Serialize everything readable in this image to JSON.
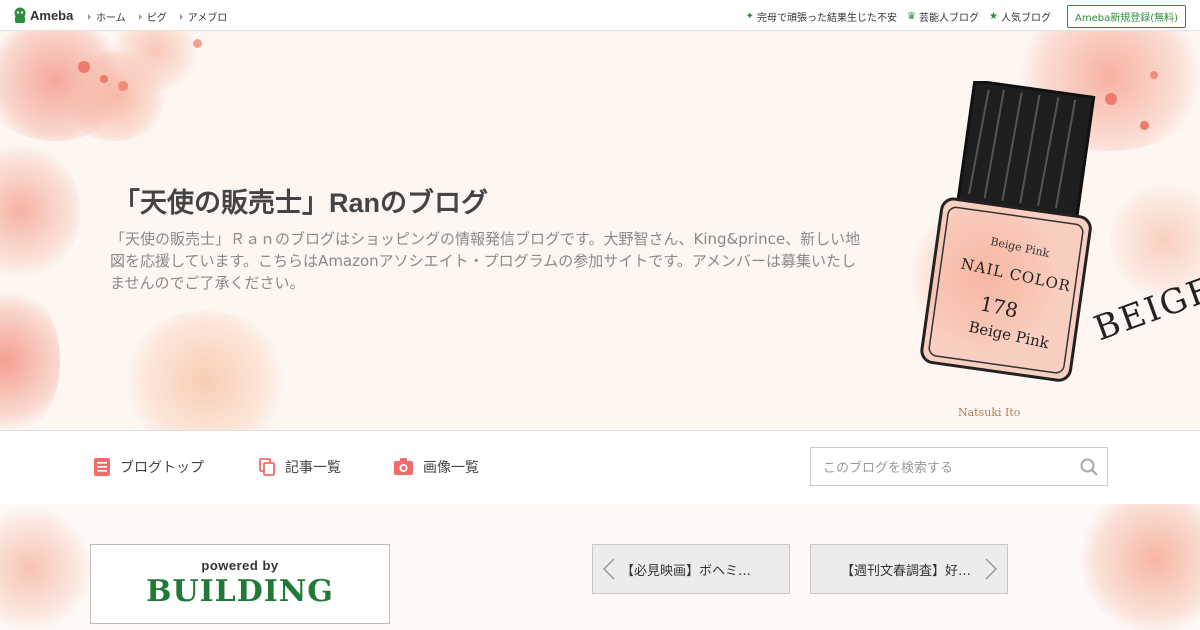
{
  "topbar": {
    "logo_text": "Ameba",
    "nav": [
      "ホーム",
      "ピグ",
      "アメブロ"
    ],
    "right_links": [
      {
        "icon": "sparkle-icon",
        "label": "完母で頑張った結果生じた不安"
      },
      {
        "icon": "crown-icon",
        "label": "芸能人ブログ"
      },
      {
        "icon": "star-icon",
        "label": "人気ブログ"
      }
    ],
    "signup_label": "Ameba新規登録(無料)"
  },
  "header": {
    "title": "「天使の販売士」Ranのブログ",
    "description": "「天使の販売士」Ｒａｎのブログはショッピングの情報発信ブログです。大野智さん、King&prince、新しい地図を応援しています。こちらはAmazonアソシエイト・プログラムの参加サイトです。アメンバーは募集いたしませんのでご了承ください。",
    "illustration": {
      "line1": "Beige Pink",
      "line2": "NAIL COLOR",
      "line3": "178",
      "line4": "Beige Pink",
      "side_text": "BEIGE",
      "artist": "Natsuki Ito"
    }
  },
  "nav": {
    "items": [
      {
        "label": "ブログトップ",
        "icon": "document-icon"
      },
      {
        "label": "記事一覧",
        "icon": "copy-icon"
      },
      {
        "label": "画像一覧",
        "icon": "camera-icon"
      }
    ],
    "search_placeholder": "このブログを検索する"
  },
  "footer": {
    "powered_by": "powered by",
    "building": "BUILDING",
    "prev_label": "【必見映画】ボヘミ…",
    "next_label": "【週刊文春調査】好…"
  },
  "colors": {
    "ameba_green": "#2d8c3c",
    "accent_red": "#f26b6b",
    "building_green": "#1f7a36"
  }
}
